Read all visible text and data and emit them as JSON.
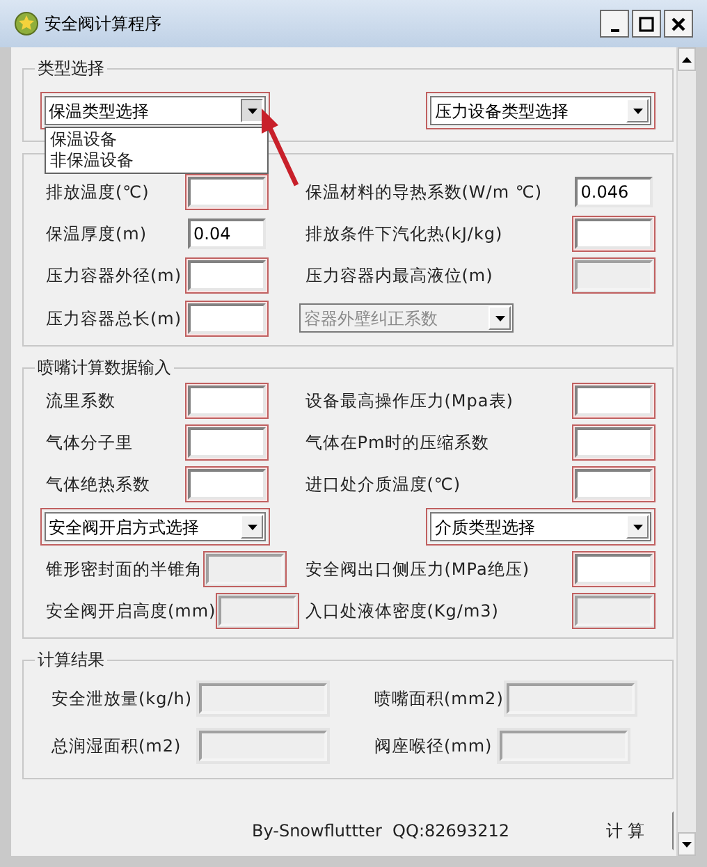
{
  "window": {
    "title": "安全阀计算程序"
  },
  "type_selection": {
    "title": "类型选择",
    "combos": [
      {
        "text": "保温类型选择",
        "required": true,
        "disabled": false,
        "open": true,
        "options": [
          "保温设备",
          "非保温设备"
        ]
      },
      {
        "text": "压力设备类型选择",
        "required": true,
        "disabled": false,
        "open": false
      }
    ]
  },
  "sections": [
    {
      "kind": "input",
      "rows": [
        [
          {
            "kind": "field",
            "label": "排放温度(℃)",
            "required": true,
            "disabled": false
          },
          {
            "kind": "field",
            "label": "保温材料的导热系数(W/m ℃)",
            "value": "0.046",
            "required": false,
            "disabled": false
          }
        ],
        [
          {
            "kind": "field",
            "label": "保温厚度(m)",
            "value": "0.04",
            "required": false,
            "disabled": false
          },
          {
            "kind": "field",
            "label": "排放条件下汽化热(kJ/kg)",
            "required": true,
            "disabled": false
          }
        ],
        [
          {
            "kind": "field",
            "label": "压力容器外径(m)",
            "required": true,
            "disabled": false
          },
          {
            "kind": "field",
            "label": "压力容器内最高液位(m)",
            "required": true,
            "disabled": true
          }
        ],
        [
          {
            "kind": "field",
            "label": "压力容器总长(m)",
            "required": true,
            "disabled": false
          },
          {
            "kind": "combo",
            "text": "容器外壁纠正系数",
            "required": false,
            "disabled": true
          }
        ]
      ]
    },
    {
      "kind": "input",
      "title": "喷嘴计算数据输入",
      "rows": [
        [
          {
            "kind": "field",
            "label": "流里系数",
            "required": true,
            "disabled": false
          },
          {
            "kind": "field",
            "label": "设备最高操作压力(Mpa表)",
            "required": true,
            "disabled": false
          }
        ],
        [
          {
            "kind": "field",
            "label": "气体分子里",
            "required": true,
            "disabled": false
          },
          {
            "kind": "field",
            "label": "气体在Pm时的压缩系数",
            "required": true,
            "disabled": false
          }
        ],
        [
          {
            "kind": "field",
            "label": "气体绝热系数",
            "required": true,
            "disabled": false
          },
          {
            "kind": "field",
            "label": "进口处介质温度(℃)",
            "required": true,
            "disabled": false
          }
        ],
        [
          {
            "kind": "combo",
            "text": "安全阀开启方式选择",
            "required": true,
            "disabled": false
          },
          {
            "kind": "combo",
            "text": "介质类型选择",
            "required": true,
            "disabled": false
          }
        ],
        [
          {
            "kind": "field",
            "label": "锥形密封面的半锥角",
            "required": true,
            "disabled": true
          },
          {
            "kind": "field",
            "label": "安全阀出口侧压力(MPa绝压)",
            "required": true,
            "disabled": false
          }
        ],
        [
          {
            "kind": "field",
            "label": "安全阀开启高度(mm)",
            "required": true,
            "disabled": true
          },
          {
            "kind": "field",
            "label": "入口处液体密度(Kg/m3)",
            "required": true,
            "disabled": true
          }
        ]
      ]
    },
    {
      "kind": "result",
      "title": "计算结果",
      "rows": [
        [
          {
            "kind": "field",
            "label": "安全泄放量(kg/h)",
            "required": false,
            "disabled": true
          },
          {
            "kind": "field",
            "label": "喷嘴面积(mm2)",
            "required": false,
            "disabled": true
          }
        ],
        [
          {
            "kind": "field",
            "label": "总润湿面积(m2)",
            "required": false,
            "disabled": true
          },
          {
            "kind": "field",
            "label": "阀座喉径(mm)",
            "required": false,
            "disabled": true
          }
        ]
      ]
    }
  ],
  "footer": {
    "credit": "By-Snowfluttter  QQ:82693212",
    "button": "计 算"
  }
}
